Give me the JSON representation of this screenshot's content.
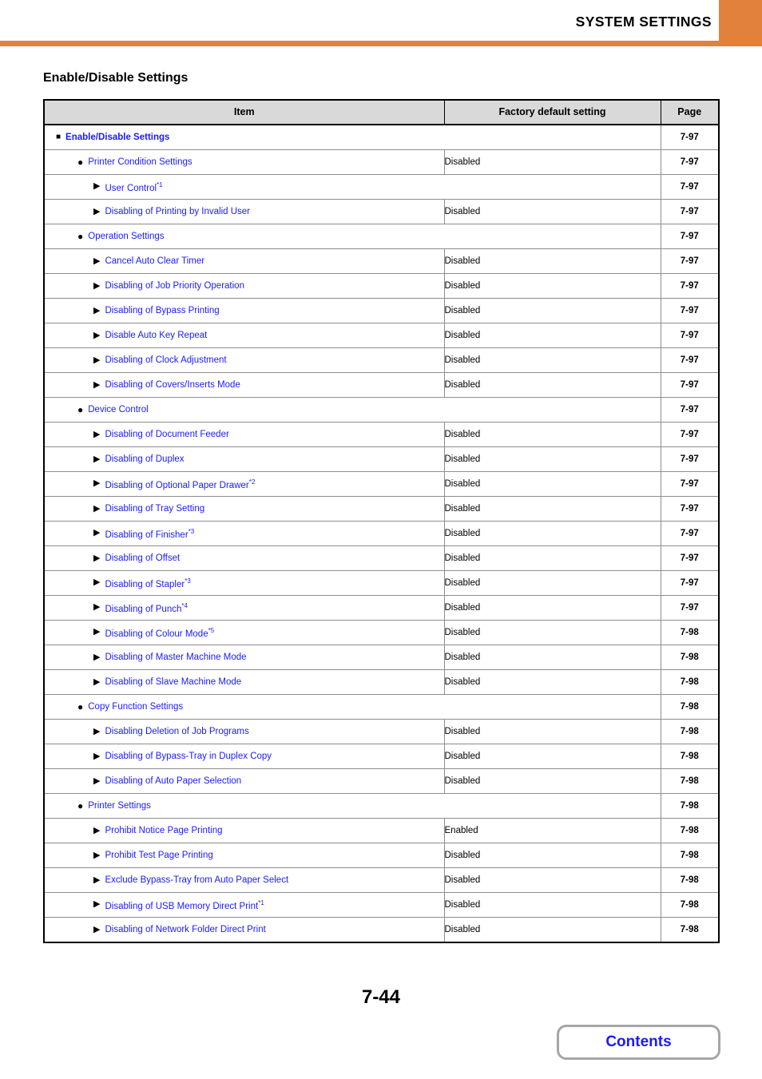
{
  "header": {
    "title": "SYSTEM SETTINGS",
    "accent_color": "#e2813b"
  },
  "section": {
    "title": "Enable/Disable Settings"
  },
  "table": {
    "columns": [
      "Item",
      "Factory default setting",
      "Page"
    ],
    "rows": [
      {
        "level": 1,
        "marker": "square",
        "label": "Enable/Disable Settings",
        "note": "",
        "default": "",
        "page": "7-97"
      },
      {
        "level": 2,
        "marker": "circle",
        "label": "Printer Condition Settings",
        "note": "",
        "default": "Disabled",
        "page": "7-97"
      },
      {
        "level": 3,
        "marker": "triangle",
        "label": "User Control",
        "note": "*1",
        "default": "",
        "page": "7-97"
      },
      {
        "level": 3,
        "marker": "triangle",
        "label": "Disabling of Printing by Invalid User",
        "note": "",
        "default": "Disabled",
        "page": "7-97"
      },
      {
        "level": 2,
        "marker": "circle",
        "label": "Operation Settings",
        "note": "",
        "default": "",
        "page": "7-97"
      },
      {
        "level": 3,
        "marker": "triangle",
        "label": "Cancel Auto Clear Timer",
        "note": "",
        "default": "Disabled",
        "page": "7-97"
      },
      {
        "level": 3,
        "marker": "triangle",
        "label": "Disabling of Job Priority Operation",
        "note": "",
        "default": "Disabled",
        "page": "7-97"
      },
      {
        "level": 3,
        "marker": "triangle",
        "label": "Disabling of Bypass Printing",
        "note": "",
        "default": "Disabled",
        "page": "7-97"
      },
      {
        "level": 3,
        "marker": "triangle",
        "label": "Disable Auto Key Repeat",
        "note": "",
        "default": "Disabled",
        "page": "7-97"
      },
      {
        "level": 3,
        "marker": "triangle",
        "label": "Disabling of Clock Adjustment",
        "note": "",
        "default": "Disabled",
        "page": "7-97"
      },
      {
        "level": 3,
        "marker": "triangle",
        "label": "Disabling of Covers/Inserts Mode",
        "note": "",
        "default": "Disabled",
        "page": "7-97"
      },
      {
        "level": 2,
        "marker": "circle",
        "label": "Device Control",
        "note": "",
        "default": "",
        "page": "7-97"
      },
      {
        "level": 3,
        "marker": "triangle",
        "label": "Disabling of Document Feeder",
        "note": "",
        "default": "Disabled",
        "page": "7-97"
      },
      {
        "level": 3,
        "marker": "triangle",
        "label": "Disabling of Duplex",
        "note": "",
        "default": "Disabled",
        "page": "7-97"
      },
      {
        "level": 3,
        "marker": "triangle",
        "label": "Disabling of Optional Paper Drawer",
        "note": "*2",
        "default": "Disabled",
        "page": "7-97"
      },
      {
        "level": 3,
        "marker": "triangle",
        "label": "Disabling of Tray Setting",
        "note": "",
        "default": "Disabled",
        "page": "7-97"
      },
      {
        "level": 3,
        "marker": "triangle",
        "label": "Disabling of Finisher",
        "note": "*3",
        "default": "Disabled",
        "page": "7-97"
      },
      {
        "level": 3,
        "marker": "triangle",
        "label": "Disabling of Offset",
        "note": "",
        "default": "Disabled",
        "page": "7-97"
      },
      {
        "level": 3,
        "marker": "triangle",
        "label": "Disabling of Stapler",
        "note": "*3",
        "default": "Disabled",
        "page": "7-97"
      },
      {
        "level": 3,
        "marker": "triangle",
        "label": "Disabling of Punch",
        "note": "*4",
        "default": "Disabled",
        "page": "7-97"
      },
      {
        "level": 3,
        "marker": "triangle",
        "label": "Disabling of Colour Mode",
        "note": "*5",
        "default": "Disabled",
        "page": "7-98"
      },
      {
        "level": 3,
        "marker": "triangle",
        "label": "Disabling of Master Machine Mode",
        "note": "",
        "default": "Disabled",
        "page": "7-98"
      },
      {
        "level": 3,
        "marker": "triangle",
        "label": "Disabling of Slave Machine Mode",
        "note": "",
        "default": "Disabled",
        "page": "7-98"
      },
      {
        "level": 2,
        "marker": "circle",
        "label": "Copy Function Settings",
        "note": "",
        "default": "",
        "page": "7-98"
      },
      {
        "level": 3,
        "marker": "triangle",
        "label": "Disabling Deletion of Job Programs",
        "note": "",
        "default": "Disabled",
        "page": "7-98"
      },
      {
        "level": 3,
        "marker": "triangle",
        "label": "Disabling of Bypass-Tray in Duplex Copy",
        "note": "",
        "default": "Disabled",
        "page": "7-98"
      },
      {
        "level": 3,
        "marker": "triangle",
        "label": "Disabling of Auto Paper Selection",
        "note": "",
        "default": "Disabled",
        "page": "7-98"
      },
      {
        "level": 2,
        "marker": "circle",
        "label": "Printer Settings",
        "note": "",
        "default": "",
        "page": "7-98"
      },
      {
        "level": 3,
        "marker": "triangle",
        "label": "Prohibit Notice Page Printing",
        "note": "",
        "default": "Enabled",
        "page": "7-98"
      },
      {
        "level": 3,
        "marker": "triangle",
        "label": "Prohibit Test Page Printing",
        "note": "",
        "default": "Disabled",
        "page": "7-98"
      },
      {
        "level": 3,
        "marker": "triangle",
        "label": "Exclude Bypass-Tray from Auto Paper Select",
        "note": "",
        "default": "Disabled",
        "page": "7-98"
      },
      {
        "level": 3,
        "marker": "triangle",
        "label": "Disabling of USB Memory Direct Print",
        "note": "*1",
        "default": "Disabled",
        "page": "7-98"
      },
      {
        "level": 3,
        "marker": "triangle",
        "label": "Disabling of Network Folder Direct Print",
        "note": "",
        "default": "Disabled",
        "page": "7-98"
      }
    ]
  },
  "footer": {
    "page_number": "7-44",
    "contents_label": "Contents"
  },
  "markers": {
    "square": "■",
    "circle": "●",
    "triangle": "▶"
  }
}
